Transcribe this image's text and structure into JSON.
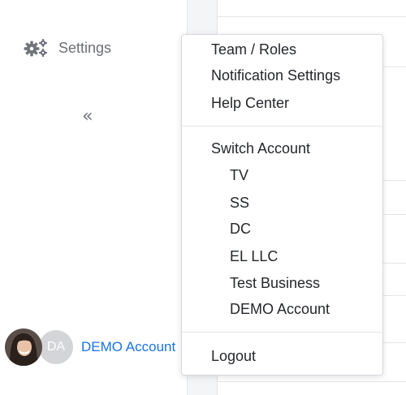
{
  "sidebar": {
    "settings_label": "Settings",
    "settings_icon": "gears-icon",
    "collapse_glyph": "«",
    "account": {
      "initials": "DA",
      "name": "DEMO Account"
    }
  },
  "menu": {
    "items": [
      {
        "label": "Team / Roles"
      },
      {
        "label": "Notification Settings"
      },
      {
        "label": "Help Center"
      }
    ],
    "switch_account": {
      "label": "Switch Account",
      "accounts": [
        "TV",
        "SS",
        "DC",
        "EL LLC",
        "Test Business",
        "DEMO Account"
      ]
    },
    "logout_label": "Logout"
  },
  "colors": {
    "link_blue": "#1a73e8",
    "muted_text": "#6b6f76",
    "menu_text": "#24272b"
  }
}
